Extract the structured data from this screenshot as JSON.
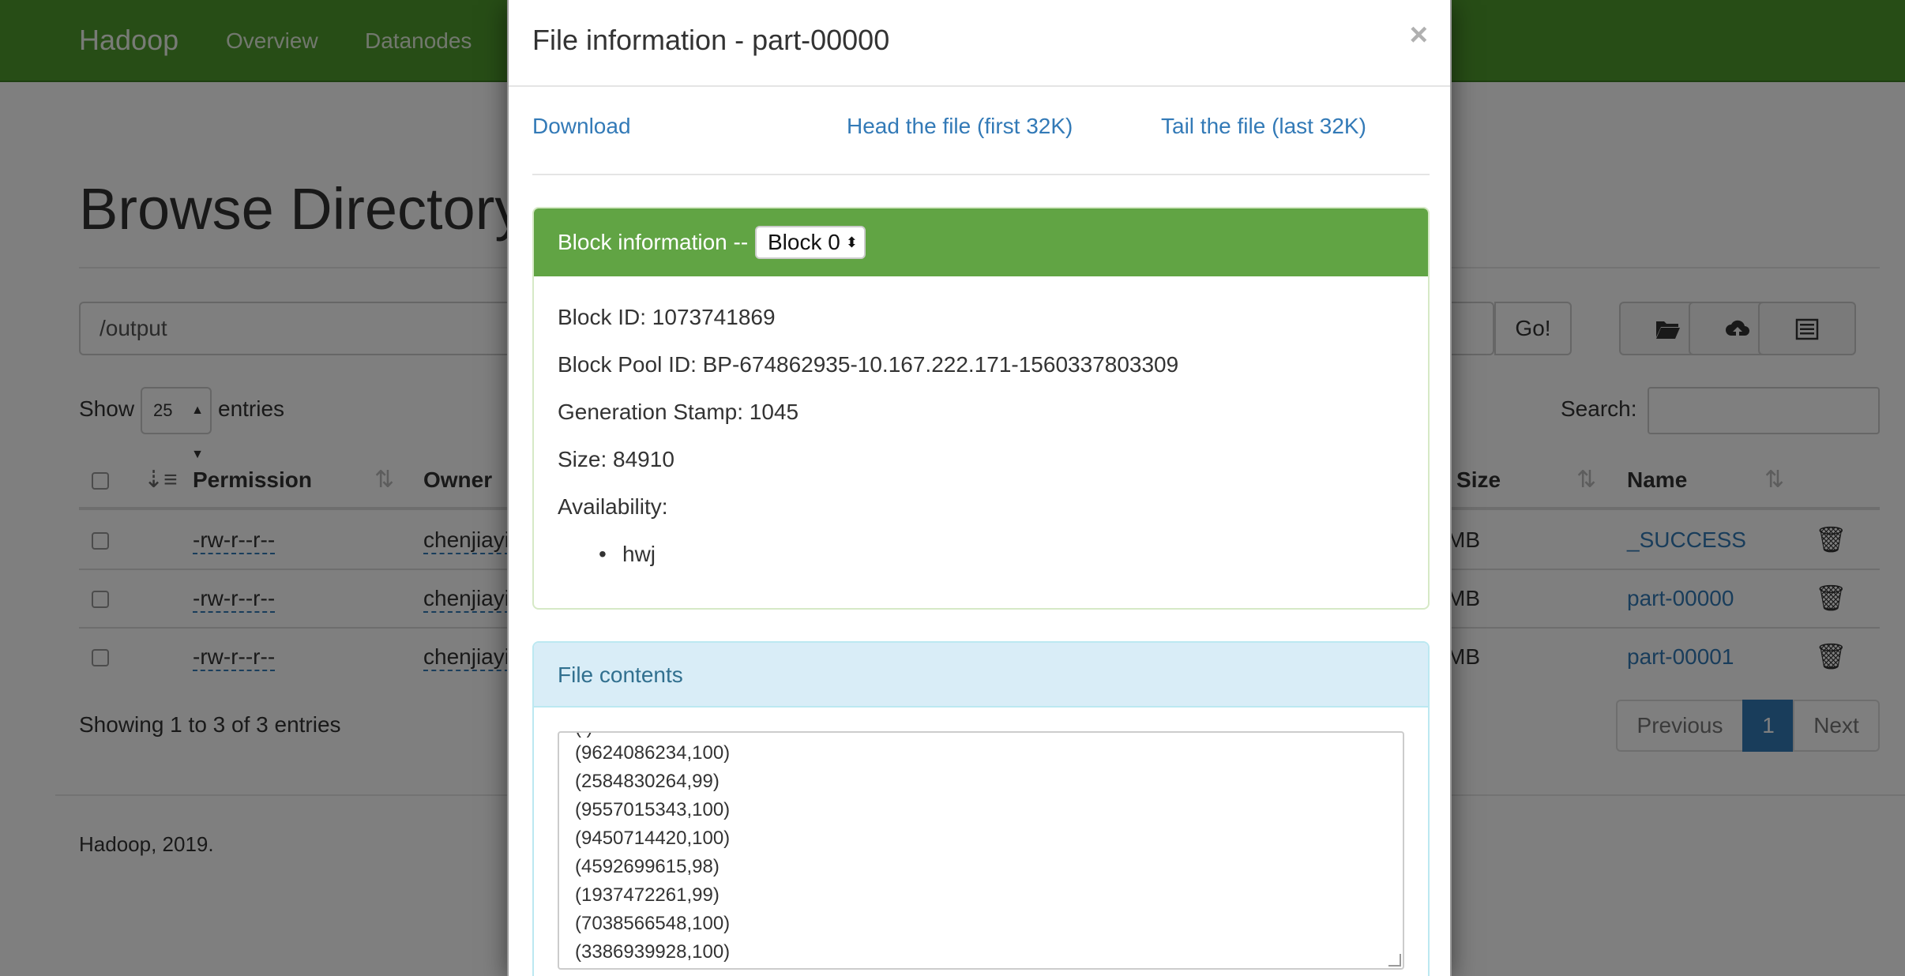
{
  "navbar": {
    "brand": "Hadoop",
    "items": [
      {
        "label": "Overview"
      },
      {
        "label": "Datanodes"
      }
    ]
  },
  "page": {
    "title": "Browse Directory",
    "path_value": "/output",
    "go_label": "Go!",
    "show_label": "Show",
    "entries_per_page": "25",
    "entries_label": "entries",
    "search_label": "Search:",
    "columns": {
      "permission": "Permission",
      "owner": "Owner",
      "block_size": "Block Size",
      "name": "Name"
    },
    "rows": [
      {
        "permission": "-rw-r--r--",
        "owner": "chenjiayi",
        "block_size": "MB",
        "name": "_SUCCESS"
      },
      {
        "permission": "-rw-r--r--",
        "owner": "chenjiayi",
        "block_size": "MB",
        "name": "part-00000"
      },
      {
        "permission": "-rw-r--r--",
        "owner": "chenjiayi",
        "block_size": "MB",
        "name": "part-00001"
      }
    ],
    "showing": "Showing 1 to 3 of 3 entries",
    "pagination": {
      "previous": "Previous",
      "current": "1",
      "next": "Next"
    },
    "footer": "Hadoop, 2019."
  },
  "modal": {
    "title": "File information - part-00000",
    "close": "×",
    "links": {
      "download": "Download",
      "head": "Head the file (first 32K)",
      "tail": "Tail the file (last 32K)"
    },
    "block_panel": {
      "heading": "Block information --",
      "selected_block": "Block 0",
      "block_id": "Block ID: 1073741869",
      "block_pool_id": "Block Pool ID: BP-674862935-10.167.222.171-1560337803309",
      "generation_stamp": "Generation Stamp: 1045",
      "size": "Size: 84910",
      "availability_label": "Availability:",
      "availability": [
        "hwj"
      ]
    },
    "contents_panel": {
      "heading": "File contents",
      "lines": [
        "(9624086234,100)",
        "(2584830264,99)",
        "(9557015343,100)",
        "(9450714420,100)",
        "(4592699615,98)",
        "(1937472261,99)",
        "(7038566548,100)",
        "(3386939928,100)"
      ]
    }
  }
}
